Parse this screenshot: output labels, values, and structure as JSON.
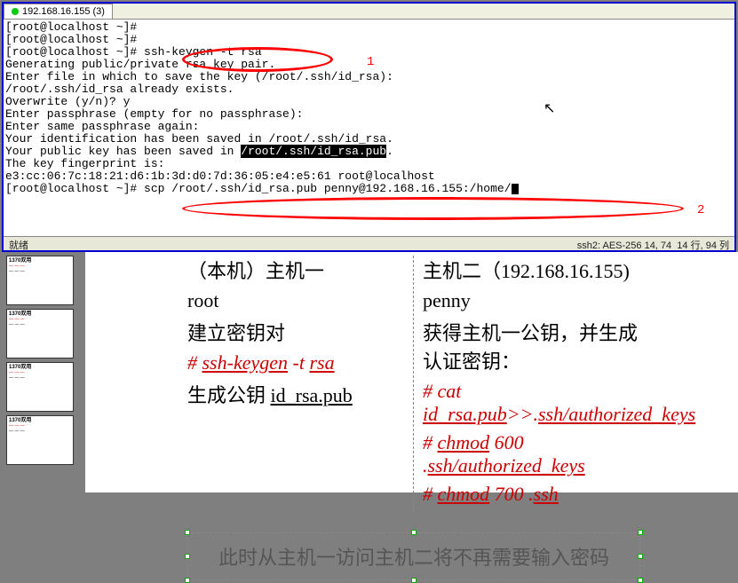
{
  "tab": {
    "title": "192.168.16.155  (3)"
  },
  "terminal": {
    "lines": [
      {
        "t": "[root@localhost ~]#",
        "i": null
      },
      {
        "t": "[root@localhost ~]#",
        "i": null
      },
      {
        "t": "[root@localhost ~]# ssh-keygen -t rsa",
        "i": null
      },
      {
        "t": "Generating public/private rsa key pair.",
        "i": null
      },
      {
        "t": "Enter file in which to save the key (/root/.ssh/id_rsa):",
        "i": null
      },
      {
        "t": "/root/.ssh/id_rsa already exists.",
        "i": null
      },
      {
        "t": "Overwrite (y/n)? y",
        "i": null
      },
      {
        "t": "Enter passphrase (empty for no passphrase):",
        "i": null
      },
      {
        "t": "Enter same passphrase again:",
        "i": null
      },
      {
        "t": "Your identification has been saved in /root/.ssh/id_rsa.",
        "i": null
      },
      {
        "t": "Your public key has been saved in ",
        "i": "/root/.ssh/id_rsa.pub",
        "after": "."
      },
      {
        "t": "The key fingerprint is:",
        "i": null
      },
      {
        "t": "e3:cc:06:7c:18:21:d6:1b:3d:d0:7d:36:05:e4:e5:61 root@localhost",
        "i": null
      },
      {
        "t": "[root@localhost ~]# scp /root/.ssh/id_rsa.pub penny@192.168.16.155:/home/",
        "i": null,
        "cursor": true
      }
    ]
  },
  "status": {
    "left": "就绪",
    "right_proto": "ssh2: AES-256   14,  74",
    "right_pos": "14 行,  94 列"
  },
  "annotations": {
    "one": "1",
    "two": "2"
  },
  "slide": {
    "left": {
      "title": "（本机）主机一",
      "user": "root",
      "step1": "建立密钥对",
      "cmd1": "# ssh-keygen -t rsa",
      "step2": "生成公钥 id_rsa.pub"
    },
    "right": {
      "title": "主机二（192.168.16.155)",
      "user": "penny",
      "step1": "获得主机一公钥，并生成认证密钥：",
      "cmd1": "# cat id_rsa.pub>>.ssh/authorized_keys",
      "cmd2": "# chmod 600 .ssh/authorized_keys",
      "cmd3": "# chmod 700 .ssh"
    },
    "footer": "此时从主机一访问主机二将不再需要输入密码"
  },
  "thumbs": [
    {
      "title": "1370双用"
    },
    {
      "title": "1370双用"
    },
    {
      "title": "1370双用"
    },
    {
      "title": "1370双用"
    }
  ]
}
